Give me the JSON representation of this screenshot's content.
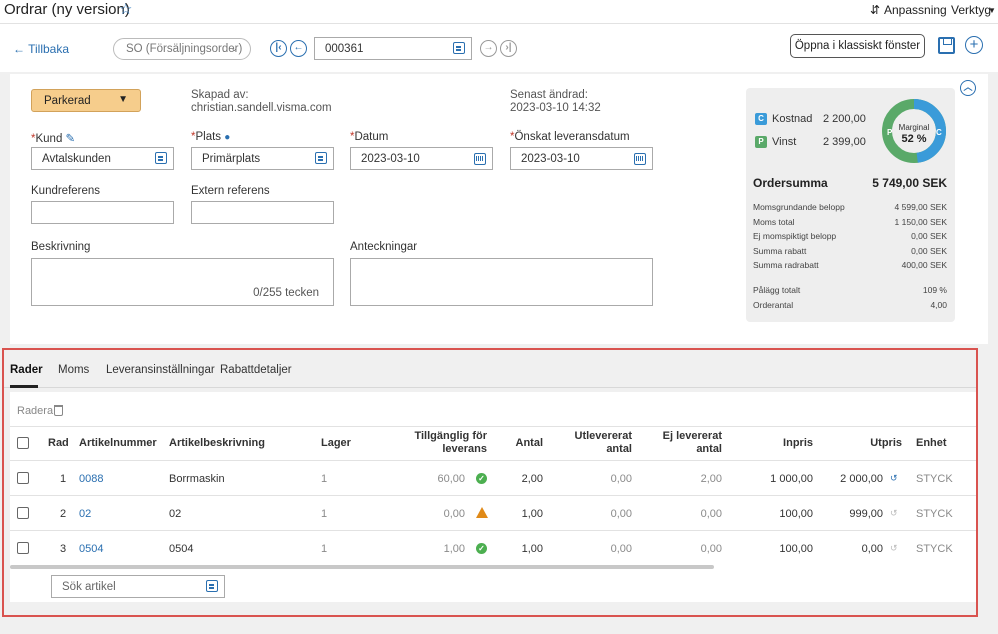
{
  "top": {
    "title": "Ordrar (ny version)",
    "customize": "Anpassning",
    "tools": "Verktyg"
  },
  "toolbar": {
    "back": "Tillbaka",
    "order_type": "SO (Försäljningsorder)",
    "order_number": "000361",
    "classic": "Öppna i klassiskt fönster"
  },
  "header": {
    "status": "Parkerad",
    "created_by_label": "Skapad av:",
    "created_by": "christian.sandell.visma.com",
    "modified_label": "Senast ändrad:",
    "modified": "2023-03-10 14:32",
    "customer_label": "Kund",
    "customer": "Avtalskunden",
    "site_label": "Plats",
    "site": "Primärplats",
    "date_label": "Datum",
    "date": "2023-03-10",
    "delivery_label": "Önskat leveransdatum",
    "delivery": "2023-03-10",
    "custref_label": "Kundreferens",
    "extref_label": "Extern referens",
    "desc_label": "Beskrivning",
    "desc_counter": "0/255 tecken",
    "notes_label": "Anteckningar"
  },
  "summary": {
    "cost_label": "Kostnad",
    "cost": "2 200,00",
    "profit_label": "Vinst",
    "profit": "2 399,00",
    "margin_label": "Marginal",
    "margin": "52 %",
    "margin_pct": 52,
    "total_label": "Ordersumma",
    "total": "5 749,00 SEK",
    "rows": [
      {
        "label": "Momsgrundande belopp",
        "value": "4 599,00 SEK"
      },
      {
        "label": "Moms total",
        "value": "1 150,00 SEK"
      },
      {
        "label": "Ej momspiktigt belopp",
        "value": "0,00 SEK"
      },
      {
        "label": "Summa rabatt",
        "value": "0,00 SEK"
      },
      {
        "label": "Summa radrabatt",
        "value": "400,00 SEK"
      }
    ],
    "rows2": [
      {
        "label": "Pålägg totalt",
        "value": "109 %"
      },
      {
        "label": "Orderantal",
        "value": "4,00"
      }
    ],
    "colors": {
      "cost": "#3a9bd9",
      "profit": "#5aa969"
    }
  },
  "tabs": [
    "Rader",
    "Moms",
    "Leveransinställningar",
    "Rabattdetaljer"
  ],
  "grid": {
    "delete": "Radera",
    "headers": {
      "rad": "Rad",
      "artnr": "Artikelnummer",
      "artdesc": "Artikelbeskrivning",
      "lager": "Lager",
      "avail1": "Tillgänglig för",
      "avail2": "leverans",
      "antal": "Antal",
      "utlev1": "Utlevererat",
      "utlev2": "antal",
      "ejlev1": "Ej levererat",
      "ejlev2": "antal",
      "inpris": "Inpris",
      "utpris": "Utpris",
      "enhet": "Enhet"
    },
    "rows": [
      {
        "rad": "1",
        "artnr": "0088",
        "desc": "Borrmaskin",
        "lager": "1",
        "avail": "60,00",
        "status": "ok",
        "antal": "2,00",
        "utlev": "0,00",
        "ejlev": "2,00",
        "inpris": "1 000,00",
        "utpris": "2 000,00",
        "enhet": "STYCK"
      },
      {
        "rad": "2",
        "artnr": "02",
        "desc": "02",
        "lager": "1",
        "avail": "0,00",
        "status": "warn",
        "antal": "1,00",
        "utlev": "0,00",
        "ejlev": "0,00",
        "inpris": "100,00",
        "utpris": "999,00",
        "enhet": "STYCK"
      },
      {
        "rad": "3",
        "artnr": "0504",
        "desc": "0504",
        "lager": "1",
        "avail": "1,00",
        "status": "ok",
        "antal": "1,00",
        "utlev": "0,00",
        "ejlev": "0,00",
        "inpris": "100,00",
        "utpris": "0,00",
        "enhet": "STYCK"
      }
    ],
    "search_placeholder": "Sök artikel"
  }
}
